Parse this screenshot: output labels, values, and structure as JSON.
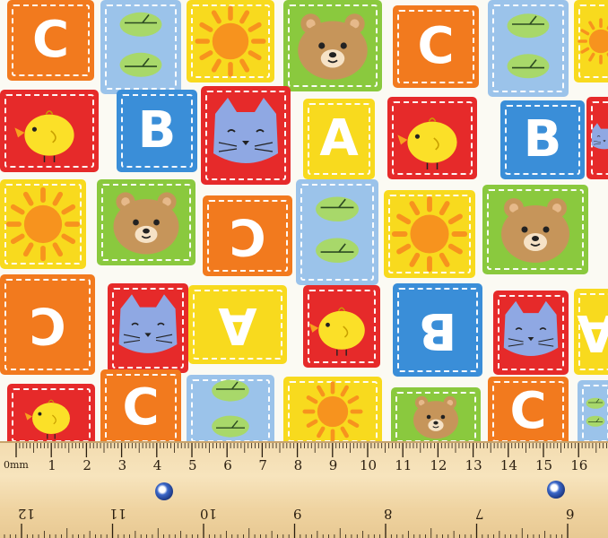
{
  "colors": {
    "red": "#e62a2a",
    "blue": "#3a8ed8",
    "yellow": "#f8da1e",
    "green": "#8ac93e",
    "orange": "#f27a1e",
    "lightblue": "#9bc3ea",
    "lightgreen": "#a8d86a",
    "sun": "#f7931e",
    "bear": "#c6955a",
    "cat": "#8fa8e3",
    "chick": "#fbe028"
  },
  "tiles": [
    {
      "name": "tile-letter-c",
      "bg": "#f27a1e",
      "motif": "letter",
      "text": "C",
      "flip": false
    },
    {
      "name": "tile-leaves",
      "bg": "#9bc3ea",
      "motif": "leaves"
    },
    {
      "name": "tile-sun",
      "bg": "#f8da1e",
      "motif": "sun"
    },
    {
      "name": "tile-bear",
      "bg": "#8ac93e",
      "motif": "bear"
    },
    {
      "name": "tile-letter-c",
      "bg": "#f27a1e",
      "motif": "letter",
      "text": "C",
      "flip": false
    },
    {
      "name": "tile-leaves",
      "bg": "#9bc3ea",
      "motif": "leaves"
    },
    {
      "name": "tile-sun",
      "bg": "#f8da1e",
      "motif": "sun"
    },
    {
      "name": "tile-chick",
      "bg": "#e62a2a",
      "motif": "chick"
    },
    {
      "name": "tile-letter-b",
      "bg": "#3a8ed8",
      "motif": "letter",
      "text": "B",
      "flip": false
    },
    {
      "name": "tile-cat",
      "bg": "#e62a2a",
      "motif": "cat"
    },
    {
      "name": "tile-letter-a",
      "bg": "#f8da1e",
      "motif": "letter",
      "text": "A",
      "flip": false
    },
    {
      "name": "tile-chick",
      "bg": "#e62a2a",
      "motif": "chick"
    },
    {
      "name": "tile-letter-b",
      "bg": "#3a8ed8",
      "motif": "letter",
      "text": "B",
      "flip": false
    },
    {
      "name": "tile-cat",
      "bg": "#e62a2a",
      "motif": "cat"
    },
    {
      "name": "tile-sun",
      "bg": "#f8da1e",
      "motif": "sun"
    },
    {
      "name": "tile-bear",
      "bg": "#8ac93e",
      "motif": "bear"
    },
    {
      "name": "tile-letter-c",
      "bg": "#f27a1e",
      "motif": "letter",
      "text": "C",
      "flip": true
    },
    {
      "name": "tile-leaves",
      "bg": "#9bc3ea",
      "motif": "leaves"
    },
    {
      "name": "tile-sun",
      "bg": "#f8da1e",
      "motif": "sun"
    },
    {
      "name": "tile-bear",
      "bg": "#8ac93e",
      "motif": "bear"
    },
    {
      "name": "tile-letter-c",
      "bg": "#f27a1e",
      "motif": "letter",
      "text": "C",
      "flip": true
    },
    {
      "name": "tile-cat",
      "bg": "#e62a2a",
      "motif": "cat"
    },
    {
      "name": "tile-letter-a",
      "bg": "#f8da1e",
      "motif": "letter",
      "text": "A",
      "flip": true
    },
    {
      "name": "tile-chick",
      "bg": "#e62a2a",
      "motif": "chick"
    },
    {
      "name": "tile-letter-b",
      "bg": "#3a8ed8",
      "motif": "letter",
      "text": "B",
      "flip": true
    },
    {
      "name": "tile-cat",
      "bg": "#e62a2a",
      "motif": "cat"
    },
    {
      "name": "tile-letter-a",
      "bg": "#f8da1e",
      "motif": "letter",
      "text": "A",
      "flip": true
    },
    {
      "name": "tile-chick",
      "bg": "#e62a2a",
      "motif": "chick"
    },
    {
      "name": "tile-letter-c",
      "bg": "#f27a1e",
      "motif": "letter",
      "text": "C",
      "flip": false
    },
    {
      "name": "tile-leaves",
      "bg": "#9bc3ea",
      "motif": "leaves"
    },
    {
      "name": "tile-sun",
      "bg": "#f8da1e",
      "motif": "sun"
    },
    {
      "name": "tile-bear",
      "bg": "#8ac93e",
      "motif": "bear"
    },
    {
      "name": "tile-letter-c",
      "bg": "#f27a1e",
      "motif": "letter",
      "text": "C",
      "flip": false
    },
    {
      "name": "tile-leaves",
      "bg": "#9bc3ea",
      "motif": "leaves"
    },
    {
      "name": "tile-sun",
      "bg": "#f8da1e",
      "motif": "sun"
    }
  ],
  "ruler": {
    "unit_label": "0mm",
    "top_numbers": [
      "1",
      "2",
      "3",
      "4",
      "5",
      "6",
      "7",
      "8",
      "9",
      "10",
      "11",
      "12",
      "13",
      "14",
      "15",
      "16"
    ],
    "bottom_numbers": [
      "12",
      "11",
      "10",
      "9",
      "8",
      "7",
      "6"
    ]
  }
}
